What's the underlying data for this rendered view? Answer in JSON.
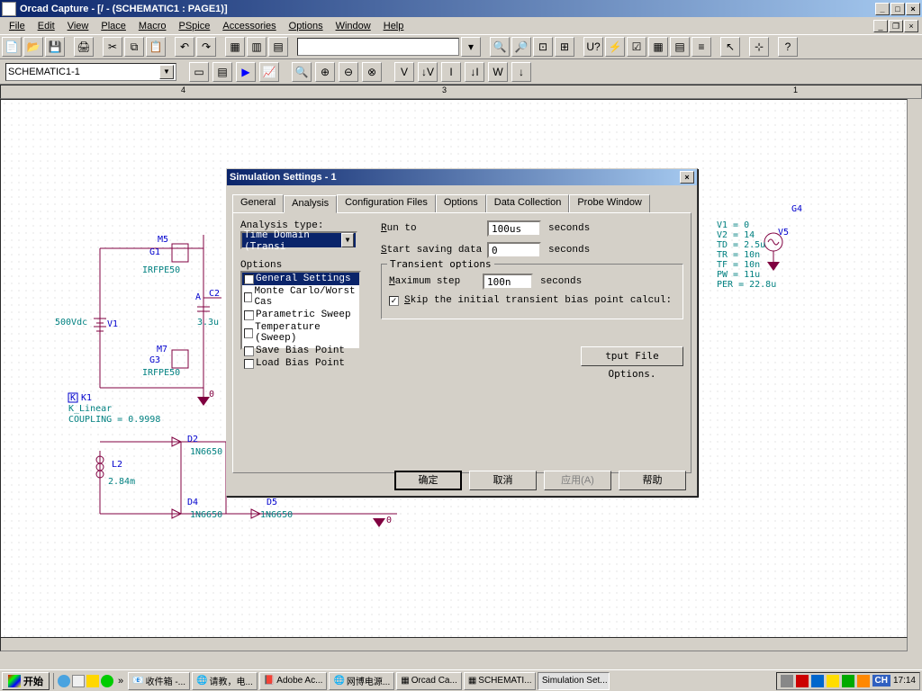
{
  "window": {
    "title": "Orcad Capture - [/ - (SCHEMATIC1 : PAGE1)]"
  },
  "menus": [
    "File",
    "Edit",
    "View",
    "Place",
    "Macro",
    "PSpice",
    "Accessories",
    "Options",
    "Window",
    "Help"
  ],
  "toolbar2": {
    "schematic_dropdown": "SCHEMATIC1-1"
  },
  "schematic": {
    "m5": "M5",
    "g1": "G1",
    "irfpe50_1": "IRFPE50",
    "c2": "C2",
    "c2_val": "3.3u",
    "v1": "V1",
    "v1_val": "500Vdc",
    "m7": "M7",
    "g3": "G3",
    "irfpe50_2": "IRFPE50",
    "gnd1": "0",
    "k1_ref": "K1",
    "k1": "K",
    "k_type": "K_Linear",
    "coupling": "COUPLING = 0.9998",
    "d2": "D2",
    "d2_val": "1N6650",
    "l2": "L2",
    "l2_val": "2.84m",
    "d4": "D4",
    "d4_val": "1N6650",
    "d5": "D5",
    "d5_val": "1N6650",
    "gnd2": "0",
    "gnd3": "0",
    "node_a": "A",
    "g4": "G4",
    "v5": "V5",
    "params": [
      "V1 = 0",
      "V2 = 14",
      "TD = 2.5u",
      "TR = 10n",
      "TF = 10n",
      "PW = 11u",
      "PER = 22.8u"
    ]
  },
  "dialog": {
    "title": "Simulation Settings - 1",
    "tabs": [
      "General",
      "Analysis",
      "Configuration Files",
      "Options",
      "Data Collection",
      "Probe Window"
    ],
    "active_tab": 1,
    "analysis_type_label": "Analysis type:",
    "analysis_type_value": "Time Domain (Transi",
    "options_label": "Options",
    "options_list": [
      {
        "label": "General Settings",
        "checked": true,
        "selected": true
      },
      {
        "label": "Monte Carlo/Worst Cas",
        "checked": false,
        "selected": false
      },
      {
        "label": "Parametric Sweep",
        "checked": false,
        "selected": false
      },
      {
        "label": "Temperature (Sweep)",
        "checked": false,
        "selected": false
      },
      {
        "label": "Save Bias Point",
        "checked": false,
        "selected": false
      },
      {
        "label": "Load Bias Point",
        "checked": false,
        "selected": false
      }
    ],
    "run_to_label": "Run to",
    "run_to_value": "100us",
    "run_to_unit": "seconds",
    "start_saving_label": "Start saving data",
    "start_saving_value": "0",
    "start_saving_unit": "seconds",
    "transient_group": "Transient options",
    "max_step_label": "Maximum step",
    "max_step_value": "100n",
    "max_step_unit": "seconds",
    "skip_initial_label": "Skip the initial transient bias point calcul:",
    "skip_initial_checked": true,
    "file_options_btn": "tput File Options.",
    "buttons": {
      "ok": "确定",
      "cancel": "取消",
      "apply": "应用(A)",
      "help": "帮助"
    }
  },
  "taskbar": {
    "start": "开始",
    "tasks": [
      "收件箱 -...",
      "请教，电...",
      "Adobe Ac...",
      "网博电源...",
      "Orcad Ca...",
      "SCHEMATI...",
      "Simulation Set..."
    ],
    "clock": "17:14",
    "ime": "CH"
  }
}
